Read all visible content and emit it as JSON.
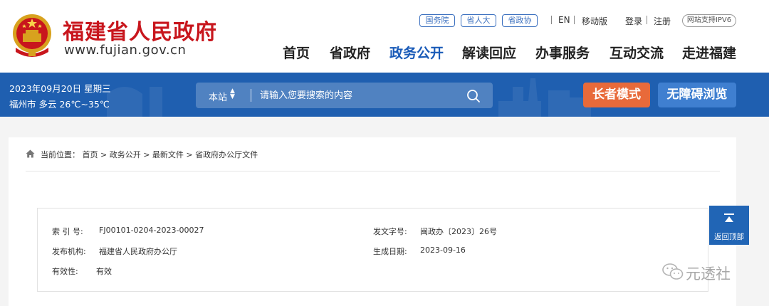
{
  "header": {
    "site_name": "福建省人民政府",
    "site_url": "www.fujian.gov.cn",
    "pills": [
      "国务院",
      "省人大",
      "省政协"
    ],
    "lang_en": "EN",
    "mobile": "移动版",
    "login": "登录",
    "register": "注册",
    "ipv6": "网站支持IPV6",
    "nav": [
      "首页",
      "省政府",
      "政务公开",
      "解读回应",
      "办事服务",
      "互动交流",
      "走进福建"
    ],
    "active_nav": "政务公开"
  },
  "banner": {
    "date": "2023年09月20日  星期三",
    "weather": "福州市  多云  26℃~35℃",
    "search_scope": "本站",
    "search_placeholder": "请输入您要搜索的内容",
    "elder_mode": "长者模式",
    "accessibility": "无障碍浏览"
  },
  "breadcrumb": {
    "text": "当前位置： 首页 > 政务公开 > 最新文件 > 省政府办公厅文件"
  },
  "info": {
    "index_label": "索 引 号:",
    "index_value": "FJ00101-0204-2023-00027",
    "doc_no_label": "发文字号:",
    "doc_no_value": "闽政办〔2023〕26号",
    "publisher_label": "发布机构:",
    "publisher_value": "福建省人民政府办公厅",
    "date_label": "生成日期:",
    "date_value": "2023-09-16",
    "validity_label": "有效性:",
    "validity_value": "有效"
  },
  "back_to_top": "返回顶部",
  "watermark": "元透社",
  "colors": {
    "brand_red": "#c8161d",
    "banner_blue": "#1f5fb0",
    "active_nav": "#1a5bb8",
    "elder_orange": "#e86a3a",
    "access_blue": "#3f7fd0"
  }
}
